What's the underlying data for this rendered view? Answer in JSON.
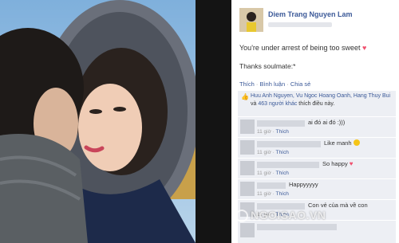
{
  "post": {
    "author": "Diem Trang Nguyen Lam",
    "text_line1": "You're under arrest of being too sweet",
    "text_line2": "Thanks soulmate:*",
    "actions": {
      "like": "Thích",
      "comment": "Bình luận",
      "share": "Chia sẻ"
    }
  },
  "likes": {
    "names": "Huu Anh Nguyen, Vu Ngoc Hoang Oanh, Hang Thuy Bui",
    "connector": "và",
    "others_link": "463 người khác",
    "suffix": "thích điều này."
  },
  "comments": [
    {
      "text": "ai đó ai đó :)))",
      "time": "11 giờ",
      "like": "Thích"
    },
    {
      "text": "Like manh",
      "time": "11 giờ",
      "like": "Thích",
      "icon": "smiley-icon"
    },
    {
      "text": "So happy",
      "time": "11 giờ",
      "like": "Thích",
      "icon": "heart-icon"
    },
    {
      "text": "Happyyyyy",
      "time": "11 giờ",
      "like": "Thích"
    },
    {
      "text": "Con vẻ của mà về con",
      "time": "11 giờ",
      "like": "Thích"
    }
  ],
  "watermark": "NGOISAO.VN",
  "colors": {
    "link": "#3b5998",
    "heart": "#f0506e",
    "comment_bg": "#edeff4"
  }
}
